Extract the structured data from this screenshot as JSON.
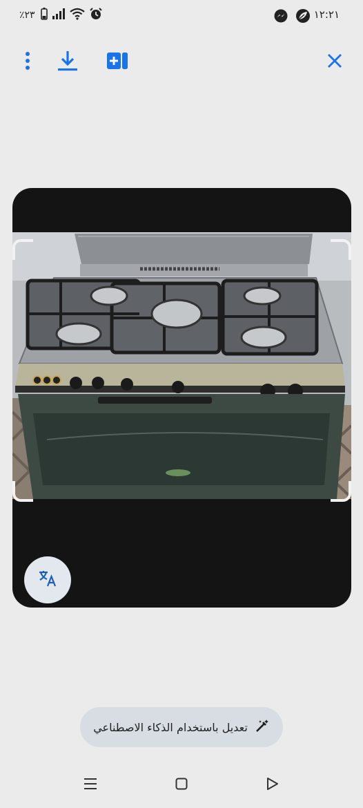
{
  "status_bar": {
    "time": "١٢:٢١",
    "battery_percent": "٪٢٣",
    "icons": [
      "messenger-icon",
      "leaf-app-icon",
      "alarm-icon",
      "wifi-icon",
      "signal-icon",
      "battery-icon"
    ]
  },
  "toolbar": {
    "icons": [
      "more-vert-icon",
      "download-icon",
      "add-to-album-icon",
      "close-icon"
    ],
    "accent_color": "#1a73e8"
  },
  "viewer": {
    "photo_subject": "gas stove with five burners and oven",
    "translate_icon": "translate-icon"
  },
  "ai_edit": {
    "label": "تعديل باستخدام الذكاء الاصطناعي",
    "icon": "magic-pen-icon"
  },
  "nav_bar": {
    "icons": [
      "menu-lines-icon",
      "home-square-icon",
      "back-triangle-icon"
    ]
  }
}
